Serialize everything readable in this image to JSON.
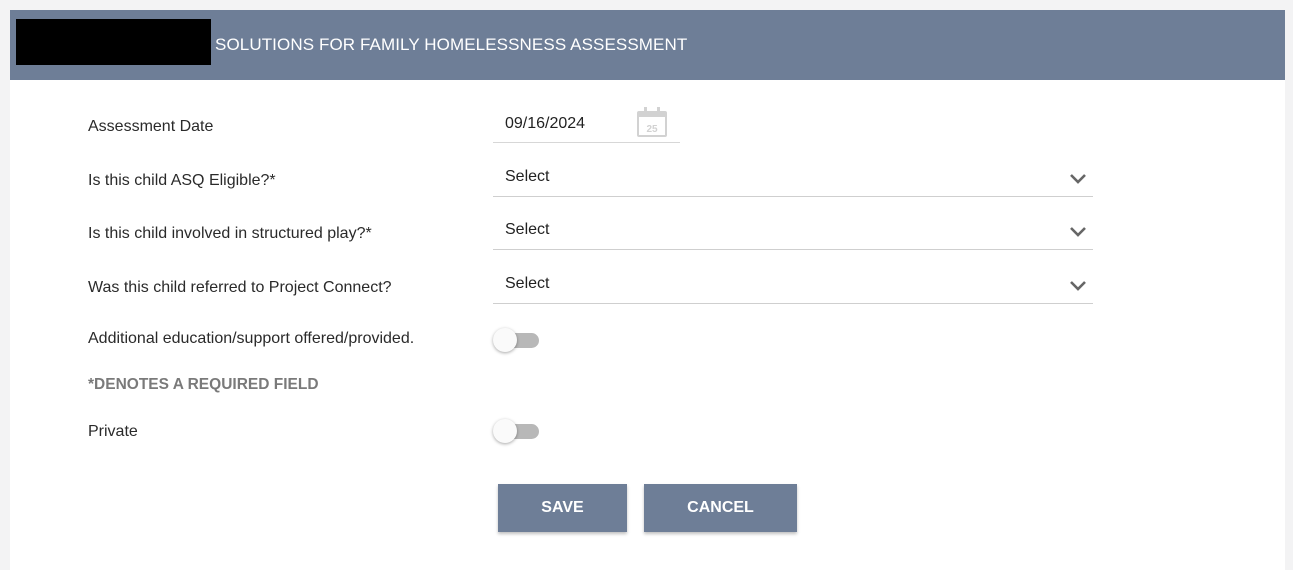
{
  "header": {
    "title": "SOLUTIONS FOR FAMILY HOMELESSNESS ASSESSMENT"
  },
  "form": {
    "assessment_date": {
      "label": "Assessment Date",
      "value": "09/16/2024",
      "calendar_icon_day": "25"
    },
    "asq_eligible": {
      "label": "Is this child ASQ Eligible?*",
      "value": "Select"
    },
    "structured_play": {
      "label": "Is this child involved in structured play?*",
      "value": "Select"
    },
    "project_connect": {
      "label": "Was this child referred to Project Connect?",
      "value": "Select"
    },
    "additional_education": {
      "label": "Additional education/support offered/provided.",
      "checked": false
    },
    "required_note": "*DENOTES A REQUIRED FIELD",
    "private": {
      "label": "Private",
      "checked": false
    }
  },
  "buttons": {
    "save": "SAVE",
    "cancel": "CANCEL"
  },
  "colors": {
    "header_bg": "#6e7e97",
    "button_bg": "#6e7e97",
    "toggle_off_track": "#b8b8b8"
  }
}
